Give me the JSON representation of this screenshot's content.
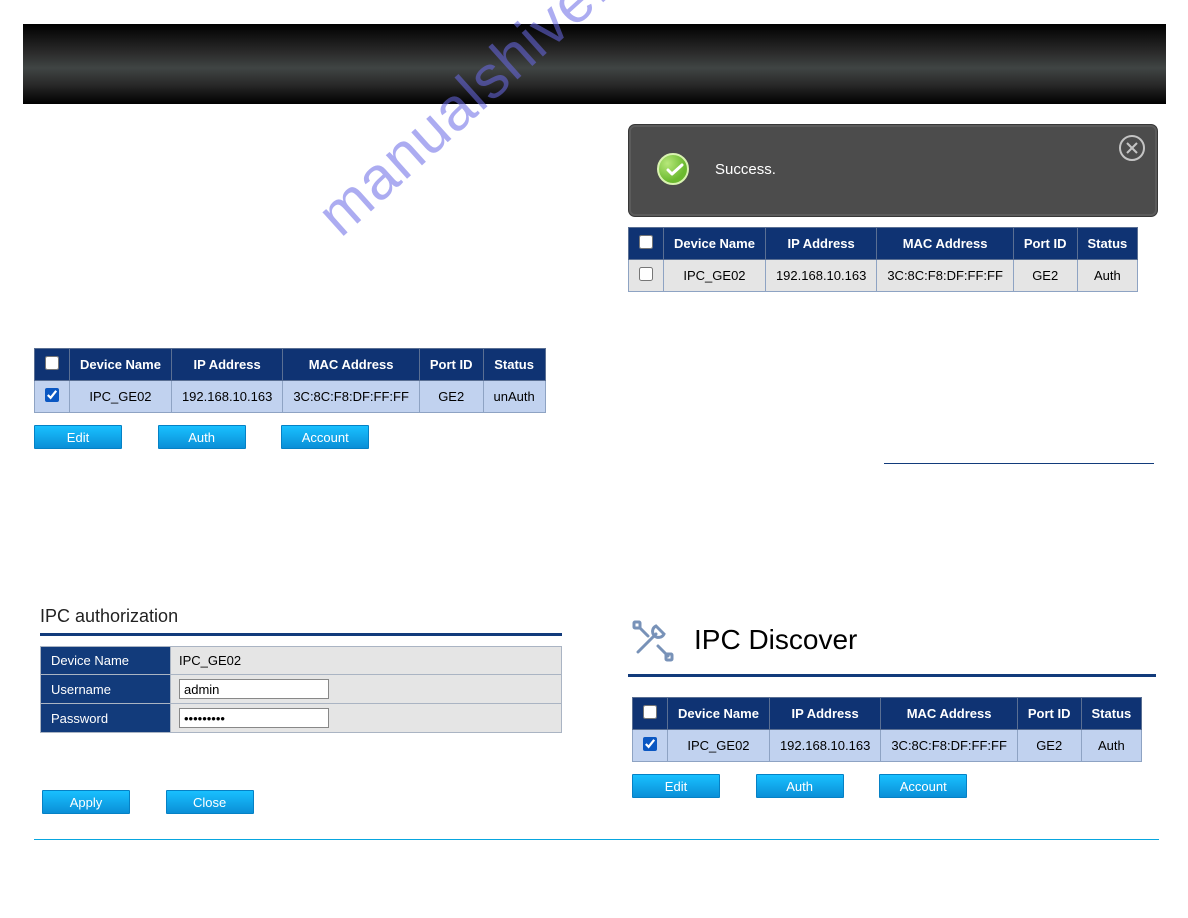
{
  "watermark": "manualshive.com",
  "toast": {
    "message": "Success."
  },
  "table_headers": {
    "device_name": "Device Name",
    "ip_address": "IP Address",
    "mac_address": "MAC Address",
    "port_id": "Port ID",
    "status": "Status"
  },
  "table_left": {
    "rows": [
      {
        "checked": true,
        "device_name": "IPC_GE02",
        "ip": "192.168.10.163",
        "mac": "3C:8C:F8:DF:FF:FF",
        "port": "GE2",
        "status": "unAuth"
      }
    ]
  },
  "table_right_1": {
    "rows": [
      {
        "checked": false,
        "device_name": "IPC_GE02",
        "ip": "192.168.10.163",
        "mac": "3C:8C:F8:DF:FF:FF",
        "port": "GE2",
        "status": "Auth"
      }
    ]
  },
  "table_right_2": {
    "rows": [
      {
        "checked": true,
        "device_name": "IPC_GE02",
        "ip": "192.168.10.163",
        "mac": "3C:8C:F8:DF:FF:FF",
        "port": "GE2",
        "status": "Auth"
      }
    ]
  },
  "buttons": {
    "edit": "Edit",
    "auth": "Auth",
    "account": "Account",
    "apply": "Apply",
    "close": "Close"
  },
  "auth_form": {
    "title": "IPC authorization",
    "labels": {
      "device": "Device Name",
      "username": "Username",
      "password": "Password"
    },
    "values": {
      "device": "IPC_GE02",
      "username": "admin",
      "password": "•••••••••"
    }
  },
  "discover": {
    "title": "IPC Discover"
  }
}
